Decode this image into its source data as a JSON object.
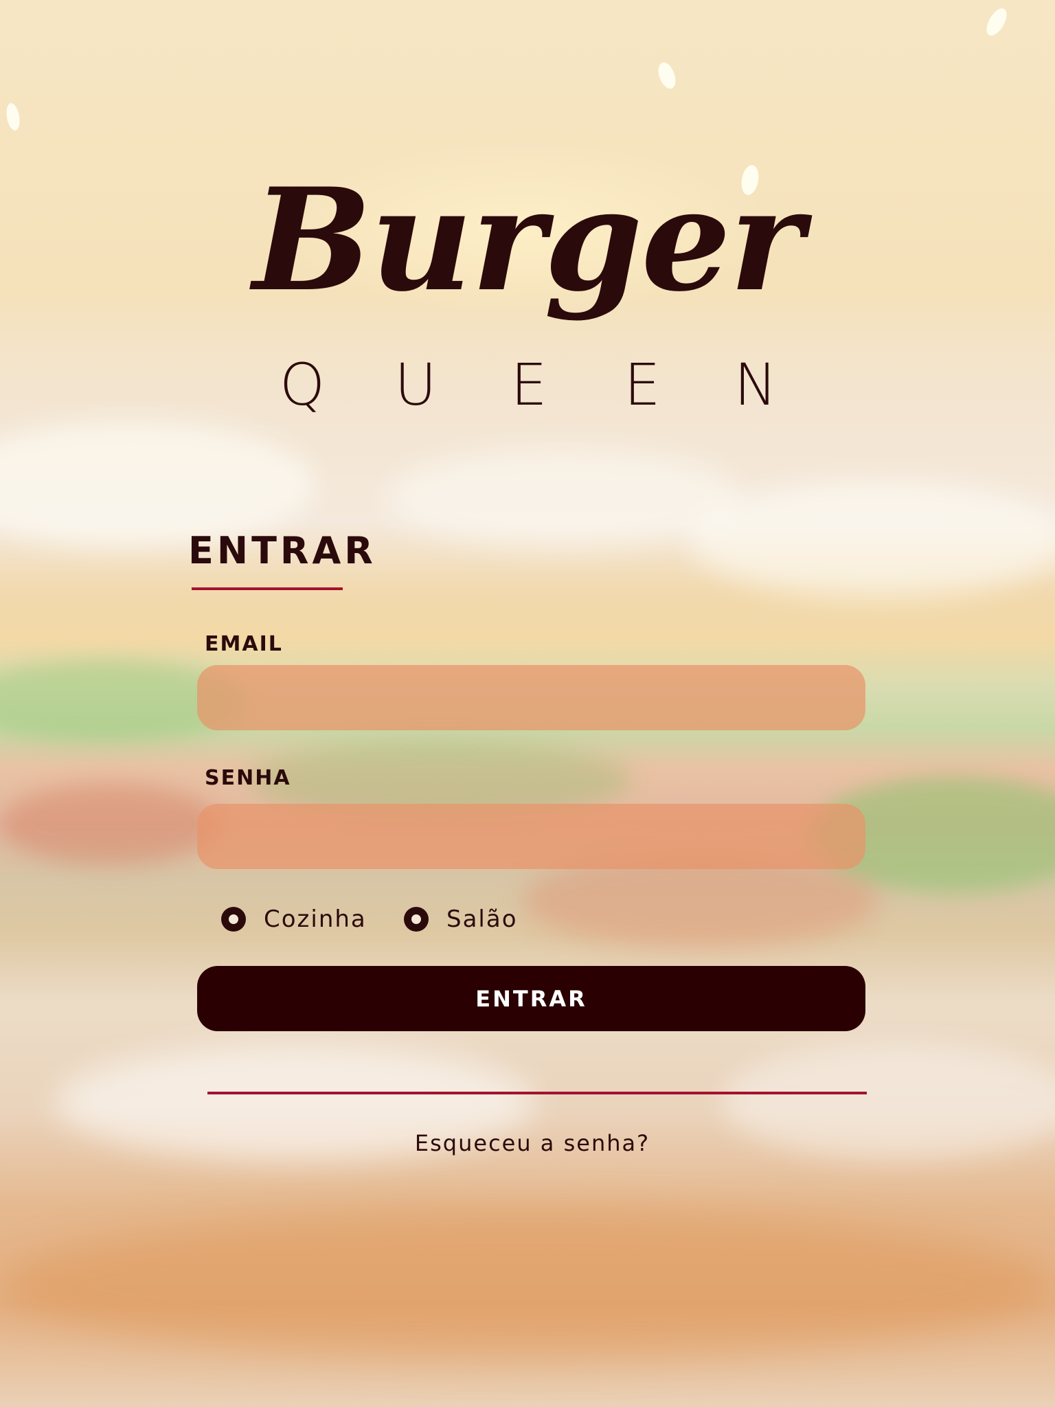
{
  "brand": {
    "title": "Burger",
    "subtitle_letters": [
      "Q",
      "U",
      "E",
      "E",
      "N"
    ]
  },
  "login": {
    "heading": "ENTRAR",
    "email": {
      "label": "EMAIL",
      "value": "",
      "placeholder": ""
    },
    "senha": {
      "label": "SENHA",
      "value": "",
      "placeholder": ""
    },
    "role_options": [
      {
        "label": "Cozinha",
        "selected": true
      },
      {
        "label": "Salão",
        "selected": true
      }
    ],
    "submit_label": "ENTRAR",
    "forgot_link": "Esqueceu a senha?"
  },
  "colors": {
    "primary_dark": "#2a0002",
    "accent_red": "#a3122f",
    "input_fill": "#e7946a"
  },
  "background": "burger-photo"
}
